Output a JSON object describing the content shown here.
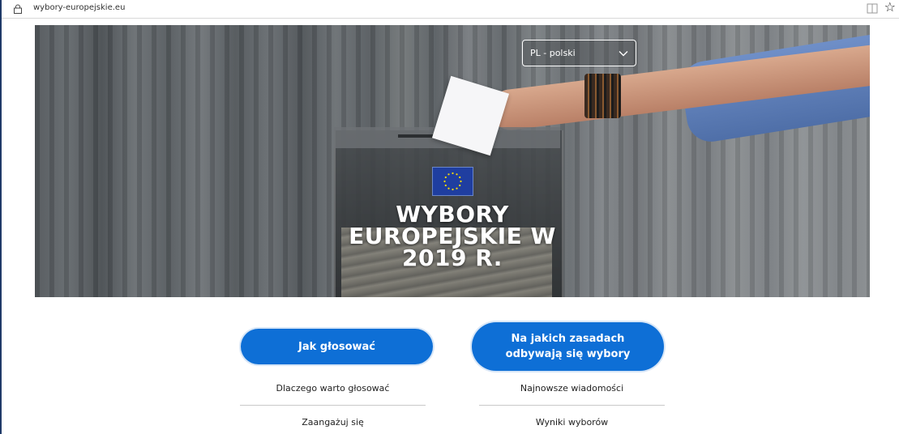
{
  "browser": {
    "url": "wybory-europejskie.eu"
  },
  "hero": {
    "language_selector": "PL - polski",
    "title_lines": [
      "WYBORY",
      "EUROPEJSKIE W",
      "2019 R."
    ]
  },
  "buttons": {
    "how_to_vote": "Jak głosować",
    "election_rules_line1": "Na jakich zasadach",
    "election_rules_line2": "odbywają się wybory"
  },
  "links": {
    "why_vote": "Dlaczego warto głosować",
    "latest_news": "Najnowsze wiadomości",
    "get_involved": "Zaangażuj się",
    "results": "Wyniki wyborów"
  },
  "colors": {
    "primary_button": "#0e6fd6",
    "eu_flag_blue": "#1f3ea0",
    "eu_star_yellow": "#ffdd00"
  }
}
